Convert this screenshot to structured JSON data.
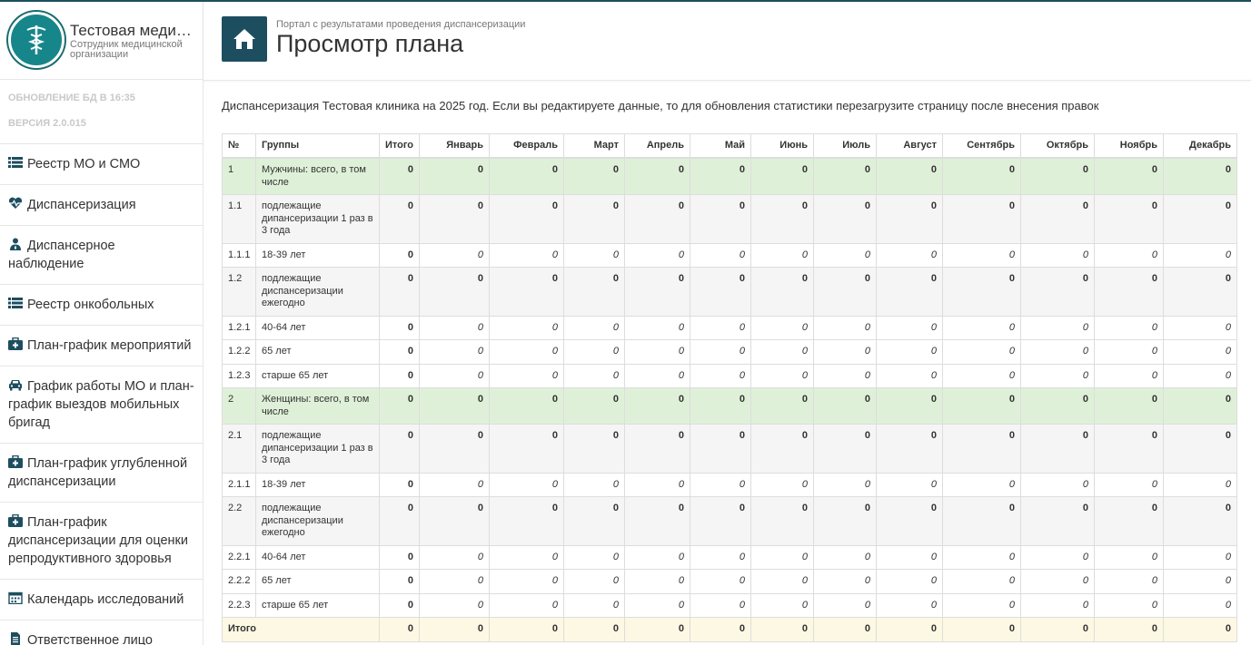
{
  "brand": {
    "title": "Тестовая меди…",
    "subtitle": "Сотрудник медицинской организации"
  },
  "meta": {
    "db_update": "ОБНОВЛЕНИЕ БД В 16:35",
    "version": "ВЕРСИЯ 2.0.015"
  },
  "nav": [
    {
      "label": "Реестр МО и СМО",
      "icon": "list-icon"
    },
    {
      "label": "Диспансеризация",
      "icon": "heartbeat-icon"
    },
    {
      "label": "Диспансерное наблюдение",
      "icon": "user-md-icon"
    },
    {
      "label": "Реестр онкобольных",
      "icon": "list-icon"
    },
    {
      "label": "План-график мероприятий",
      "icon": "medkit-icon"
    },
    {
      "label": "График работы МО и план-график выездов мобильных бригад",
      "icon": "car-icon"
    },
    {
      "label": "План-график углубленной диспансеризации",
      "icon": "medkit-icon"
    },
    {
      "label": "План-график диспансеризации для оценки репродуктивного здоровья",
      "icon": "medkit-icon"
    },
    {
      "label": "Календарь исследований",
      "icon": "calendar-icon"
    },
    {
      "label": "Ответственное лицо",
      "icon": "file-icon"
    }
  ],
  "header": {
    "breadcrumb": "Портал с результатами проведения диспансеризации",
    "title": "Просмотр плана",
    "home_icon": "home-icon"
  },
  "notice": "Диспансеризация Тестовая клиника на 2025 год. Если вы редактируете данные, то для обновления статистики перезагрузите страницу после внесения правок",
  "table": {
    "headers": [
      "№",
      "Группы",
      "Итого",
      "Январь",
      "Февраль",
      "Март",
      "Апрель",
      "Май",
      "Июнь",
      "Июль",
      "Август",
      "Сентябрь",
      "Октябрь",
      "Ноябрь",
      "Декабрь"
    ],
    "rows": [
      {
        "num": "1",
        "group": "Мужчины: всего, в том числе",
        "type": "grp",
        "total": "0",
        "months": [
          "0",
          "0",
          "0",
          "0",
          "0",
          "0",
          "0",
          "0",
          "0",
          "0",
          "0",
          "0"
        ]
      },
      {
        "num": "1.1",
        "group": "подлежащие дипансеризации 1 раз в 3 года",
        "type": "shade",
        "total": "0",
        "months": [
          "0",
          "0",
          "0",
          "0",
          "0",
          "0",
          "0",
          "0",
          "0",
          "0",
          "0",
          "0"
        ]
      },
      {
        "num": "1.1.1",
        "group": "18-39 лет",
        "type": "input",
        "total": "0",
        "months": [
          "0",
          "0",
          "0",
          "0",
          "0",
          "0",
          "0",
          "0",
          "0",
          "0",
          "0",
          "0"
        ]
      },
      {
        "num": "1.2",
        "group": "подлежащие диспансеризации ежегодно",
        "type": "shade",
        "total": "0",
        "months": [
          "0",
          "0",
          "0",
          "0",
          "0",
          "0",
          "0",
          "0",
          "0",
          "0",
          "0",
          "0"
        ]
      },
      {
        "num": "1.2.1",
        "group": "40-64 лет",
        "type": "input",
        "total": "0",
        "months": [
          "0",
          "0",
          "0",
          "0",
          "0",
          "0",
          "0",
          "0",
          "0",
          "0",
          "0",
          "0"
        ]
      },
      {
        "num": "1.2.2",
        "group": "65 лет",
        "type": "input",
        "total": "0",
        "months": [
          "0",
          "0",
          "0",
          "0",
          "0",
          "0",
          "0",
          "0",
          "0",
          "0",
          "0",
          "0"
        ]
      },
      {
        "num": "1.2.3",
        "group": "старше 65 лет",
        "type": "input",
        "total": "0",
        "months": [
          "0",
          "0",
          "0",
          "0",
          "0",
          "0",
          "0",
          "0",
          "0",
          "0",
          "0",
          "0"
        ]
      },
      {
        "num": "2",
        "group": "Женщины: всего, в том числе",
        "type": "grp",
        "total": "0",
        "months": [
          "0",
          "0",
          "0",
          "0",
          "0",
          "0",
          "0",
          "0",
          "0",
          "0",
          "0",
          "0"
        ]
      },
      {
        "num": "2.1",
        "group": "подлежащие дипансеризации 1 раз в 3 года",
        "type": "shade",
        "total": "0",
        "months": [
          "0",
          "0",
          "0",
          "0",
          "0",
          "0",
          "0",
          "0",
          "0",
          "0",
          "0",
          "0"
        ]
      },
      {
        "num": "2.1.1",
        "group": "18-39 лет",
        "type": "input",
        "total": "0",
        "months": [
          "0",
          "0",
          "0",
          "0",
          "0",
          "0",
          "0",
          "0",
          "0",
          "0",
          "0",
          "0"
        ]
      },
      {
        "num": "2.2",
        "group": "подлежащие диспансеризации ежегодно",
        "type": "shade",
        "total": "0",
        "months": [
          "0",
          "0",
          "0",
          "0",
          "0",
          "0",
          "0",
          "0",
          "0",
          "0",
          "0",
          "0"
        ]
      },
      {
        "num": "2.2.1",
        "group": "40-64 лет",
        "type": "input",
        "total": "0",
        "months": [
          "0",
          "0",
          "0",
          "0",
          "0",
          "0",
          "0",
          "0",
          "0",
          "0",
          "0",
          "0"
        ]
      },
      {
        "num": "2.2.2",
        "group": "65 лет",
        "type": "input",
        "total": "0",
        "months": [
          "0",
          "0",
          "0",
          "0",
          "0",
          "0",
          "0",
          "0",
          "0",
          "0",
          "0",
          "0"
        ]
      },
      {
        "num": "2.2.3",
        "group": "старше 65 лет",
        "type": "input",
        "total": "0",
        "months": [
          "0",
          "0",
          "0",
          "0",
          "0",
          "0",
          "0",
          "0",
          "0",
          "0",
          "0",
          "0"
        ]
      }
    ],
    "footer": {
      "label": "Итого",
      "total": "0",
      "months": [
        "0",
        "0",
        "0",
        "0",
        "0",
        "0",
        "0",
        "0",
        "0",
        "0",
        "0",
        "0"
      ]
    }
  },
  "colors": {
    "accent": "#1d4e5f",
    "logo": "#17868a",
    "group_row": "#dff0d8",
    "footer_row": "#fcf8e3",
    "shade_row": "#f5f5f5"
  }
}
